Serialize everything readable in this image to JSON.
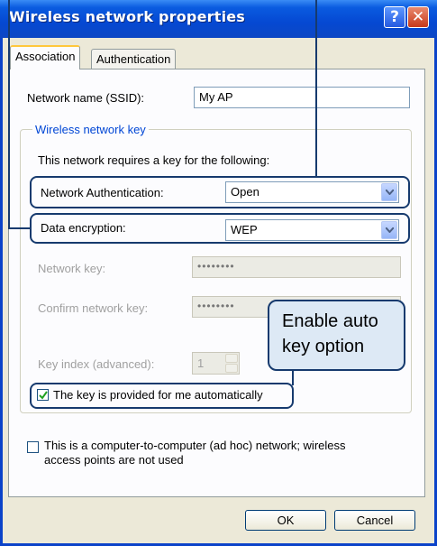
{
  "window": {
    "title": "Wireless network properties",
    "help_label": "?",
    "close_label": "✕"
  },
  "tabs": [
    {
      "label": "Association",
      "active": true
    },
    {
      "label": "Authentication",
      "active": false
    }
  ],
  "ssid": {
    "label": "Network name (SSID):",
    "value": "My AP"
  },
  "key_group": {
    "title": "Wireless network key",
    "description": "This network requires a key for the following:",
    "network_auth": {
      "label": "Network Authentication:",
      "value": "Open"
    },
    "data_encryption": {
      "label": "Data encryption:",
      "value": "WEP"
    },
    "network_key": {
      "label": "Network key:",
      "value": "••••••••"
    },
    "confirm_key": {
      "label": "Confirm network key:",
      "value": "••••••••"
    },
    "key_index": {
      "label": "Key index (advanced):",
      "value": "1"
    },
    "auto_key": {
      "label": "The key is provided for me automatically",
      "checked": true
    }
  },
  "adhoc": {
    "label_line1": "This is a computer-to-computer (ad hoc) network; wireless",
    "label_line2": "access points are not used",
    "checked": false
  },
  "buttons": {
    "ok": "OK",
    "cancel": "Cancel"
  },
  "callout": {
    "line1": "Enable auto",
    "line2": "key option"
  },
  "colors": {
    "highlight": "#163a6e",
    "callout_fill": "#dde9f5",
    "titlebar": "#0548d2"
  }
}
